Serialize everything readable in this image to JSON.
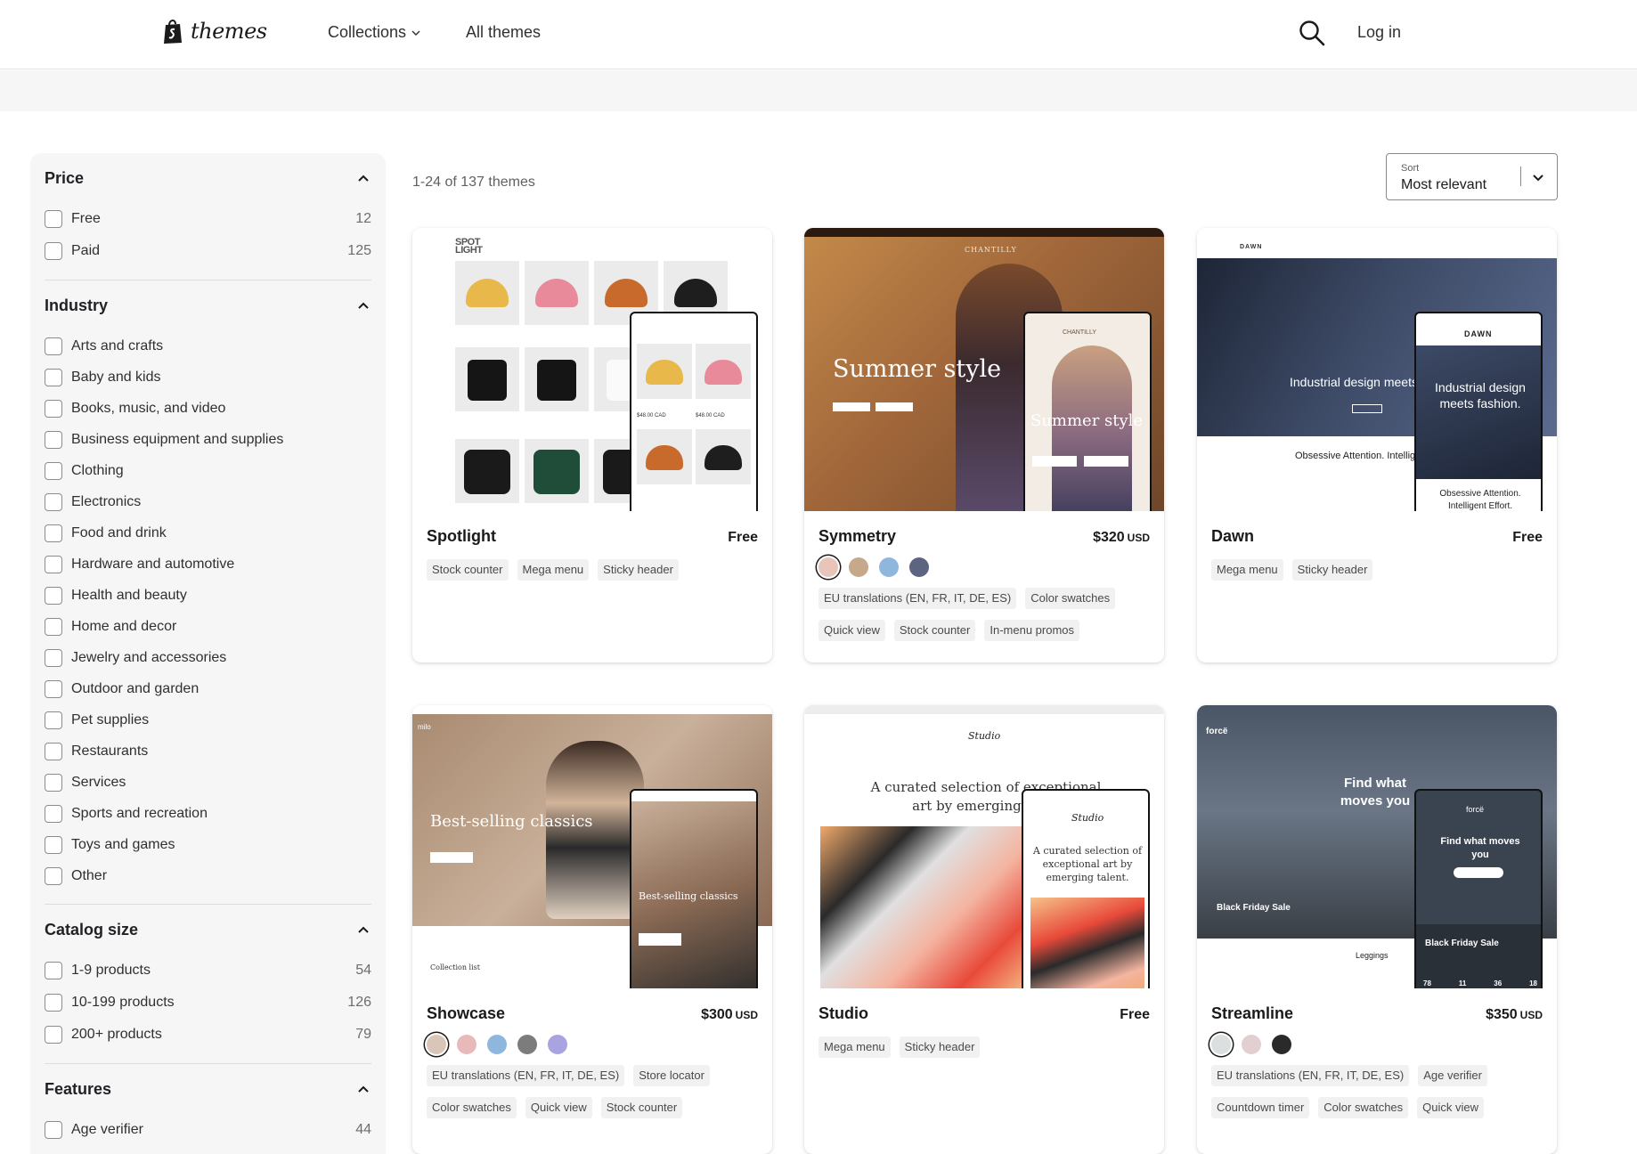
{
  "header": {
    "logo_text": "themes",
    "nav": {
      "collections": "Collections",
      "all_themes": "All themes"
    },
    "login": "Log in"
  },
  "sidebar": {
    "price": {
      "title": "Price",
      "items": [
        {
          "label": "Free",
          "count": "12"
        },
        {
          "label": "Paid",
          "count": "125"
        }
      ]
    },
    "industry": {
      "title": "Industry",
      "items": [
        {
          "label": "Arts and crafts"
        },
        {
          "label": "Baby and kids"
        },
        {
          "label": "Books, music, and video"
        },
        {
          "label": "Business equipment and supplies"
        },
        {
          "label": "Clothing"
        },
        {
          "label": "Electronics"
        },
        {
          "label": "Food and drink"
        },
        {
          "label": "Hardware and automotive"
        },
        {
          "label": "Health and beauty"
        },
        {
          "label": "Home and decor"
        },
        {
          "label": "Jewelry and accessories"
        },
        {
          "label": "Outdoor and garden"
        },
        {
          "label": "Pet supplies"
        },
        {
          "label": "Restaurants"
        },
        {
          "label": "Services"
        },
        {
          "label": "Sports and recreation"
        },
        {
          "label": "Toys and games"
        },
        {
          "label": "Other"
        }
      ]
    },
    "catalog": {
      "title": "Catalog size",
      "items": [
        {
          "label": "1-9 products",
          "count": "54"
        },
        {
          "label": "10-199 products",
          "count": "126"
        },
        {
          "label": "200+ products",
          "count": "79"
        }
      ]
    },
    "features": {
      "title": "Features",
      "items": [
        {
          "label": "Age verifier",
          "count": "44"
        }
      ]
    }
  },
  "main": {
    "results": "1-24 of 137 themes",
    "sort": {
      "label": "Sort",
      "value": "Most relevant"
    }
  },
  "themes": [
    {
      "name": "Spotlight",
      "price": "Free",
      "currency": "",
      "swatches": [],
      "tags": [
        "Stock counter",
        "Mega menu",
        "Sticky header"
      ],
      "preview": {
        "logo": "SPOT LIGHT",
        "prices": [
          "$48.00 CAD",
          "$48.00 CAD"
        ]
      }
    },
    {
      "name": "Symmetry",
      "price": "$320",
      "currency": "USD",
      "swatches": [
        "#e9c4b8",
        "#c6a98a",
        "#8fb6dd",
        "#5d6480"
      ],
      "tags": [
        "EU translations (EN, FR, IT, DE, ES)",
        "Color swatches",
        "Quick view",
        "Stock counter",
        "In-menu promos"
      ],
      "preview": {
        "brand": "CHANTILLY",
        "headline": "Summer style"
      }
    },
    {
      "name": "Dawn",
      "price": "Free",
      "currency": "",
      "swatches": [],
      "tags": [
        "Mega menu",
        "Sticky header"
      ],
      "preview": {
        "brand": "DAWN",
        "headline": "Industrial design meets fashion.",
        "headline_short": "Industrial design meets",
        "tagline": "Obsessive Attention. Intelligent Effort.",
        "tagline_short": "Obsessive Attention. Intellig"
      }
    },
    {
      "name": "Showcase",
      "price": "$300",
      "currency": "USD",
      "swatches": [
        "#d9c6b8",
        "#e8b9bb",
        "#8fb6dd",
        "#7c7c7c",
        "#a9a4e0"
      ],
      "tags": [
        "EU translations (EN, FR, IT, DE, ES)",
        "Store locator",
        "Color swatches",
        "Quick view",
        "Stock counter"
      ],
      "preview": {
        "brand": "milo",
        "headline": "Best-selling classics",
        "caption": "Collection list"
      }
    },
    {
      "name": "Studio",
      "price": "Free",
      "currency": "",
      "swatches": [],
      "tags": [
        "Mega menu",
        "Sticky header"
      ],
      "preview": {
        "brand": "Studio",
        "headline": "A curated selection of exceptional art by emerging talent.",
        "headline_short": "A curated selection of exceptional art by emerging talen"
      }
    },
    {
      "name": "Streamline",
      "price": "$350",
      "currency": "USD",
      "swatches": [
        "#dcdfe0",
        "#e3cfcf",
        "#2a2a2a"
      ],
      "tags": [
        "EU translations (EN, FR, IT, DE, ES)",
        "Age verifier",
        "Countdown timer",
        "Color swatches",
        "Quick view"
      ],
      "preview": {
        "brand": "forcë",
        "headline": "Find what moves you",
        "sale": "Black Friday Sale",
        "product": "Leggings",
        "countdown": [
          "78",
          "11",
          "36",
          "18"
        ]
      }
    }
  ],
  "colors": {
    "text": "#1a1a1a",
    "muted": "#616161",
    "sidebar_bg": "#f6f6f7",
    "tag_bg": "#f1f1f1"
  }
}
